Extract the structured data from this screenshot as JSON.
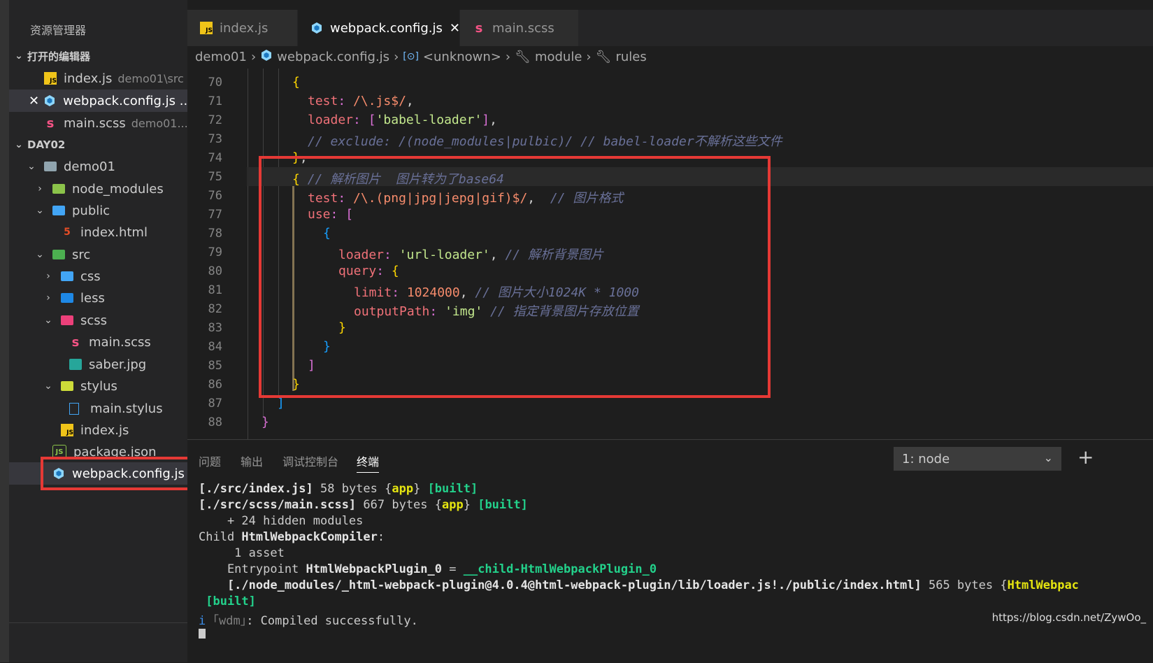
{
  "sidebar": {
    "title": "资源管理器",
    "open_editors_label": "打开的编辑器",
    "open_editors": [
      {
        "name": "index.js",
        "path": "demo01\\src",
        "icon": "js-icon"
      },
      {
        "name": "webpack.config.js ...",
        "path": "",
        "icon": "webpack-icon"
      },
      {
        "name": "main.scss",
        "path": "demo01...",
        "icon": "sass-icon"
      }
    ],
    "workspace_label": "DAY02",
    "tree": [
      {
        "name": "demo01",
        "icon": "folder-icon"
      },
      {
        "name": "node_modules",
        "icon": "node-folder-icon"
      },
      {
        "name": "public",
        "icon": "public-folder-icon"
      },
      {
        "name": "index.html",
        "icon": "html-icon"
      },
      {
        "name": "src",
        "icon": "src-folder-icon"
      },
      {
        "name": "css",
        "icon": "css-folder-icon"
      },
      {
        "name": "less",
        "icon": "less-folder-icon"
      },
      {
        "name": "scss",
        "icon": "scss-folder-icon"
      },
      {
        "name": "main.scss",
        "icon": "sass-icon"
      },
      {
        "name": "saber.jpg",
        "icon": "image-icon"
      },
      {
        "name": "stylus",
        "icon": "stylus-folder-icon"
      },
      {
        "name": "main.stylus",
        "icon": "file-icon"
      },
      {
        "name": "index.js",
        "icon": "js-icon"
      },
      {
        "name": "package.json",
        "icon": "json-icon"
      },
      {
        "name": "webpack.config.js",
        "icon": "webpack-icon"
      }
    ]
  },
  "tabs": [
    {
      "label": "index.js",
      "icon": "js-icon"
    },
    {
      "label": "webpack.config.js",
      "icon": "webpack-icon"
    },
    {
      "label": "main.scss",
      "icon": "sass-icon"
    }
  ],
  "breadcrumb": [
    "demo01",
    "webpack.config.js",
    "<unknown>",
    "module",
    "rules"
  ],
  "editor": {
    "line_numbers": [
      "70",
      "71",
      "72",
      "73",
      "74",
      "75",
      "76",
      "77",
      "78",
      "79",
      "80",
      "81",
      "82",
      "83",
      "84",
      "85",
      "86",
      "87",
      "88"
    ]
  },
  "panel": {
    "tabs": [
      "问题",
      "输出",
      "调试控制台",
      "终端"
    ],
    "terminal_select": "1: node",
    "plus_label": "+"
  },
  "terminal": {
    "l1a": "[./src/index.js]",
    "l1b": " 58 bytes {",
    "l1c": "app",
    "l1d": "} ",
    "l1e": "[built]",
    "l2a": "[./src/scss/main.scss]",
    "l2b": " 667 bytes {",
    "l2c": "app",
    "l2d": "} ",
    "l2e": "[built]",
    "l3": "    + 24 hidden modules",
    "l4a": "Child ",
    "l4b": "HtmlWebpackCompiler",
    "l4c": ":",
    "l5": "     1 asset",
    "l6a": "    Entrypoint ",
    "l6b": "HtmlWebpackPlugin_0",
    "l6c": " = ",
    "l6d": "__child-HtmlWebpackPlugin_0",
    "l7a": "    [./node_modules/_html-webpack-plugin@4.0.4@html-webpack-plugin/lib/loader.js!./public/index.html]",
    "l7b": " 565 bytes {",
    "l7c": "HtmlWebpac",
    "l8": " [built]",
    "l9a": "i ",
    "l9b": "｢wdm｣",
    "l9c": ": Compiled successfully."
  },
  "watermark": "https://blog.csdn.net/ZywOo_",
  "colors": {
    "highlight_box": "#e53935",
    "background": "#1e1e1e",
    "sidebar": "#252526"
  }
}
